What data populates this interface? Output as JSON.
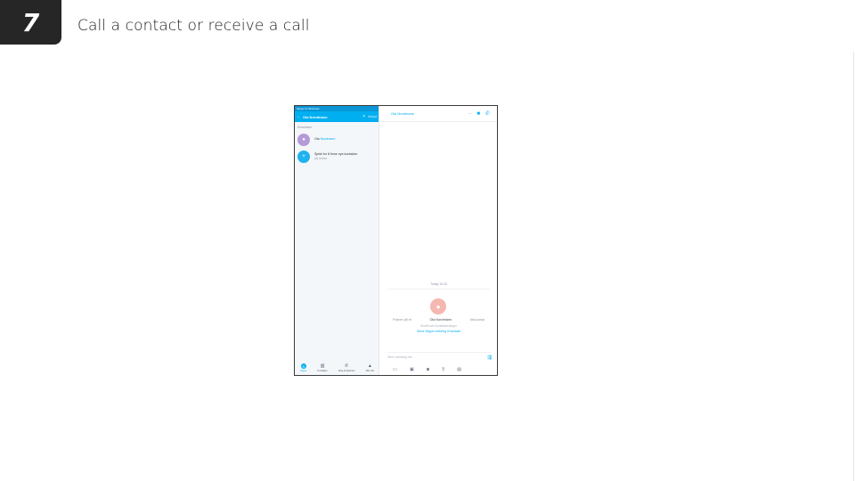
{
  "slide": {
    "number": "7",
    "title": "Call a contact or receive a call"
  },
  "app": {
    "window_title": "Skype for Business",
    "search": {
      "term": "Ola Nordmann",
      "cancel_label": "Avbryt"
    },
    "results_header": "Resultater",
    "results": [
      {
        "name_prefix": "Ola ",
        "name_highlight": "Nordmann",
        "sub": ""
      },
      {
        "name_prefix": "Sjekk for å finne nye kontakter",
        "name_highlight": "",
        "sub": "på nettet"
      }
    ],
    "nav": [
      {
        "label": "Skype",
        "icon": "skype-icon"
      },
      {
        "label": "Kontakter",
        "icon": "contacts-icon"
      },
      {
        "label": "Ring til telefoner",
        "icon": "phone-icon"
      },
      {
        "label": "Min info",
        "icon": "profile-icon"
      }
    ],
    "conversation": {
      "contact_name": "Ola Nordmann",
      "date_label": "Today 10:15",
      "ping_left": "Prøver på et",
      "ping_name": "Ola Nordmann",
      "ping_right": "dial posta",
      "ping_sub": "Sendt bare kontaktsendinger",
      "ping_link": "Send Skype-melding til kontakt",
      "compose_placeholder": "Skriv melding her"
    },
    "colors": {
      "accent": "#00aff0",
      "avatar1": "#b49ad8",
      "avatar2": "#1fb3ee",
      "conv_avatar": "#f4b8b0"
    }
  }
}
